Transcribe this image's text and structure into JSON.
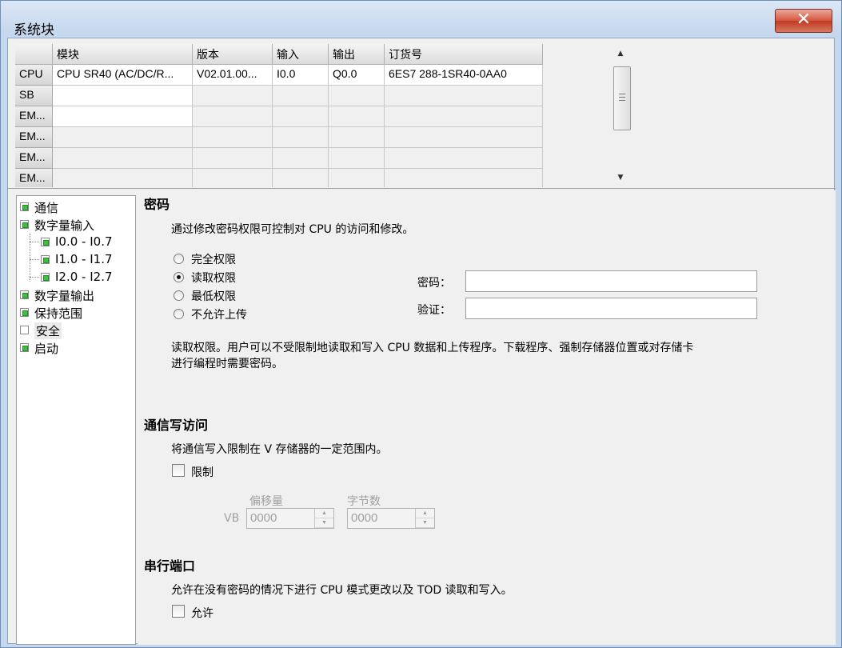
{
  "window": {
    "title": "系统块",
    "close_glyph": "✕"
  },
  "grid": {
    "headers": [
      "",
      "模块",
      "版本",
      "输入",
      "输出",
      "订货号"
    ],
    "rows": [
      {
        "slot": "CPU",
        "module": "CPU SR40 (AC/DC/R...",
        "version": "V02.01.00...",
        "input": "I0.0",
        "output": "Q0.0",
        "order": "6ES7 288-1SR40-0AA0"
      },
      {
        "slot": "SB",
        "module": "",
        "version": "",
        "input": "",
        "output": "",
        "order": ""
      },
      {
        "slot": "EM...",
        "module": "",
        "version": "",
        "input": "",
        "output": "",
        "order": ""
      },
      {
        "slot": "EM...",
        "module": "",
        "version": "",
        "input": "",
        "output": "",
        "order": ""
      },
      {
        "slot": "EM...",
        "module": "",
        "version": "",
        "input": "",
        "output": "",
        "order": ""
      },
      {
        "slot": "EM...",
        "module": "",
        "version": "",
        "input": "",
        "output": "",
        "order": ""
      }
    ],
    "scroll_up": "▲",
    "scroll_down": "▼"
  },
  "tree": {
    "items": [
      {
        "label": "通信",
        "checked": true
      },
      {
        "label": "数字量输入",
        "checked": true
      },
      {
        "label": "I0.0 - I0.7",
        "checked": true
      },
      {
        "label": "I1.0 - I1.7",
        "checked": true
      },
      {
        "label": "I2.0 - I2.7",
        "checked": true
      },
      {
        "label": "数字量输出",
        "checked": true
      },
      {
        "label": "保持范围",
        "checked": true
      },
      {
        "label": "安全",
        "checked": false
      },
      {
        "label": "启动",
        "checked": true
      }
    ],
    "selected": "安全"
  },
  "password": {
    "heading": "密码",
    "description": "通过修改密码权限可控制对 CPU 的访问和修改。",
    "options": [
      "完全权限",
      "读取权限",
      "最低权限",
      "不允许上传"
    ],
    "selected": "读取权限",
    "password_label": "密码：",
    "verify_label": "验证：",
    "password_value": "",
    "verify_value": "",
    "explanation_line1": "读取权限。用户可以不受限制地读取和写入 CPU 数据和上传程序。下载程序、强制存储器位置或对存储卡",
    "explanation_line2": "进行编程时需要密码。"
  },
  "comm_write": {
    "heading": "通信写访问",
    "description": "将通信写入限制在 V 存储器的一定范围内。",
    "restrict_label": "限制",
    "restrict_checked": false,
    "offset_label": "偏移量",
    "bytes_label": "字节数",
    "prefix": "VB",
    "offset_value": "0000",
    "bytes_value": "0000"
  },
  "serial_port": {
    "heading": "串行端口",
    "description": "允许在没有密码的情况下进行 CPU 模式更改以及 TOD 读取和写入。",
    "allow_label": "允许",
    "allow_checked": false
  }
}
